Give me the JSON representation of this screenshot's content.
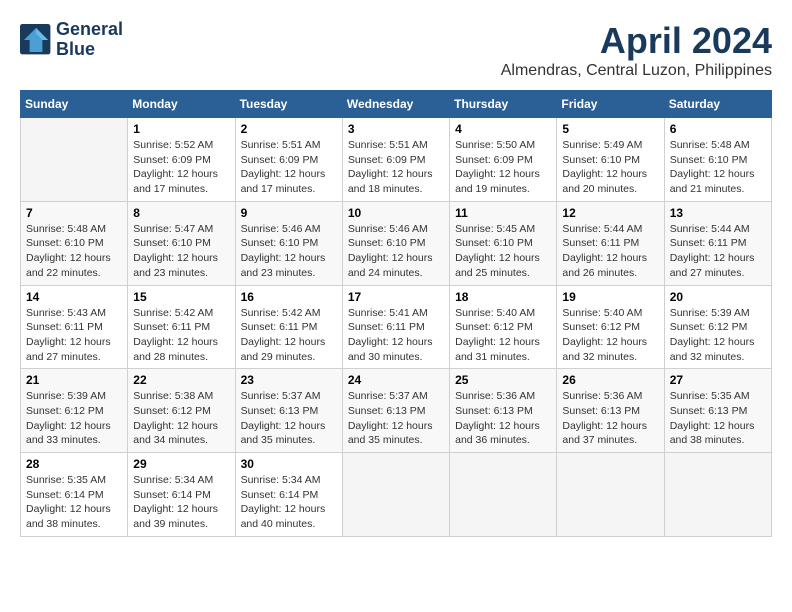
{
  "logo": {
    "line1": "General",
    "line2": "Blue"
  },
  "title": "April 2024",
  "location": "Almendras, Central Luzon, Philippines",
  "weekdays": [
    "Sunday",
    "Monday",
    "Tuesday",
    "Wednesday",
    "Thursday",
    "Friday",
    "Saturday"
  ],
  "weeks": [
    [
      {
        "day": "",
        "info": ""
      },
      {
        "day": "1",
        "info": "Sunrise: 5:52 AM\nSunset: 6:09 PM\nDaylight: 12 hours\nand 17 minutes."
      },
      {
        "day": "2",
        "info": "Sunrise: 5:51 AM\nSunset: 6:09 PM\nDaylight: 12 hours\nand 17 minutes."
      },
      {
        "day": "3",
        "info": "Sunrise: 5:51 AM\nSunset: 6:09 PM\nDaylight: 12 hours\nand 18 minutes."
      },
      {
        "day": "4",
        "info": "Sunrise: 5:50 AM\nSunset: 6:09 PM\nDaylight: 12 hours\nand 19 minutes."
      },
      {
        "day": "5",
        "info": "Sunrise: 5:49 AM\nSunset: 6:10 PM\nDaylight: 12 hours\nand 20 minutes."
      },
      {
        "day": "6",
        "info": "Sunrise: 5:48 AM\nSunset: 6:10 PM\nDaylight: 12 hours\nand 21 minutes."
      }
    ],
    [
      {
        "day": "7",
        "info": "Sunrise: 5:48 AM\nSunset: 6:10 PM\nDaylight: 12 hours\nand 22 minutes."
      },
      {
        "day": "8",
        "info": "Sunrise: 5:47 AM\nSunset: 6:10 PM\nDaylight: 12 hours\nand 23 minutes."
      },
      {
        "day": "9",
        "info": "Sunrise: 5:46 AM\nSunset: 6:10 PM\nDaylight: 12 hours\nand 23 minutes."
      },
      {
        "day": "10",
        "info": "Sunrise: 5:46 AM\nSunset: 6:10 PM\nDaylight: 12 hours\nand 24 minutes."
      },
      {
        "day": "11",
        "info": "Sunrise: 5:45 AM\nSunset: 6:10 PM\nDaylight: 12 hours\nand 25 minutes."
      },
      {
        "day": "12",
        "info": "Sunrise: 5:44 AM\nSunset: 6:11 PM\nDaylight: 12 hours\nand 26 minutes."
      },
      {
        "day": "13",
        "info": "Sunrise: 5:44 AM\nSunset: 6:11 PM\nDaylight: 12 hours\nand 27 minutes."
      }
    ],
    [
      {
        "day": "14",
        "info": "Sunrise: 5:43 AM\nSunset: 6:11 PM\nDaylight: 12 hours\nand 27 minutes."
      },
      {
        "day": "15",
        "info": "Sunrise: 5:42 AM\nSunset: 6:11 PM\nDaylight: 12 hours\nand 28 minutes."
      },
      {
        "day": "16",
        "info": "Sunrise: 5:42 AM\nSunset: 6:11 PM\nDaylight: 12 hours\nand 29 minutes."
      },
      {
        "day": "17",
        "info": "Sunrise: 5:41 AM\nSunset: 6:11 PM\nDaylight: 12 hours\nand 30 minutes."
      },
      {
        "day": "18",
        "info": "Sunrise: 5:40 AM\nSunset: 6:12 PM\nDaylight: 12 hours\nand 31 minutes."
      },
      {
        "day": "19",
        "info": "Sunrise: 5:40 AM\nSunset: 6:12 PM\nDaylight: 12 hours\nand 32 minutes."
      },
      {
        "day": "20",
        "info": "Sunrise: 5:39 AM\nSunset: 6:12 PM\nDaylight: 12 hours\nand 32 minutes."
      }
    ],
    [
      {
        "day": "21",
        "info": "Sunrise: 5:39 AM\nSunset: 6:12 PM\nDaylight: 12 hours\nand 33 minutes."
      },
      {
        "day": "22",
        "info": "Sunrise: 5:38 AM\nSunset: 6:12 PM\nDaylight: 12 hours\nand 34 minutes."
      },
      {
        "day": "23",
        "info": "Sunrise: 5:37 AM\nSunset: 6:13 PM\nDaylight: 12 hours\nand 35 minutes."
      },
      {
        "day": "24",
        "info": "Sunrise: 5:37 AM\nSunset: 6:13 PM\nDaylight: 12 hours\nand 35 minutes."
      },
      {
        "day": "25",
        "info": "Sunrise: 5:36 AM\nSunset: 6:13 PM\nDaylight: 12 hours\nand 36 minutes."
      },
      {
        "day": "26",
        "info": "Sunrise: 5:36 AM\nSunset: 6:13 PM\nDaylight: 12 hours\nand 37 minutes."
      },
      {
        "day": "27",
        "info": "Sunrise: 5:35 AM\nSunset: 6:13 PM\nDaylight: 12 hours\nand 38 minutes."
      }
    ],
    [
      {
        "day": "28",
        "info": "Sunrise: 5:35 AM\nSunset: 6:14 PM\nDaylight: 12 hours\nand 38 minutes."
      },
      {
        "day": "29",
        "info": "Sunrise: 5:34 AM\nSunset: 6:14 PM\nDaylight: 12 hours\nand 39 minutes."
      },
      {
        "day": "30",
        "info": "Sunrise: 5:34 AM\nSunset: 6:14 PM\nDaylight: 12 hours\nand 40 minutes."
      },
      {
        "day": "",
        "info": ""
      },
      {
        "day": "",
        "info": ""
      },
      {
        "day": "",
        "info": ""
      },
      {
        "day": "",
        "info": ""
      }
    ]
  ]
}
